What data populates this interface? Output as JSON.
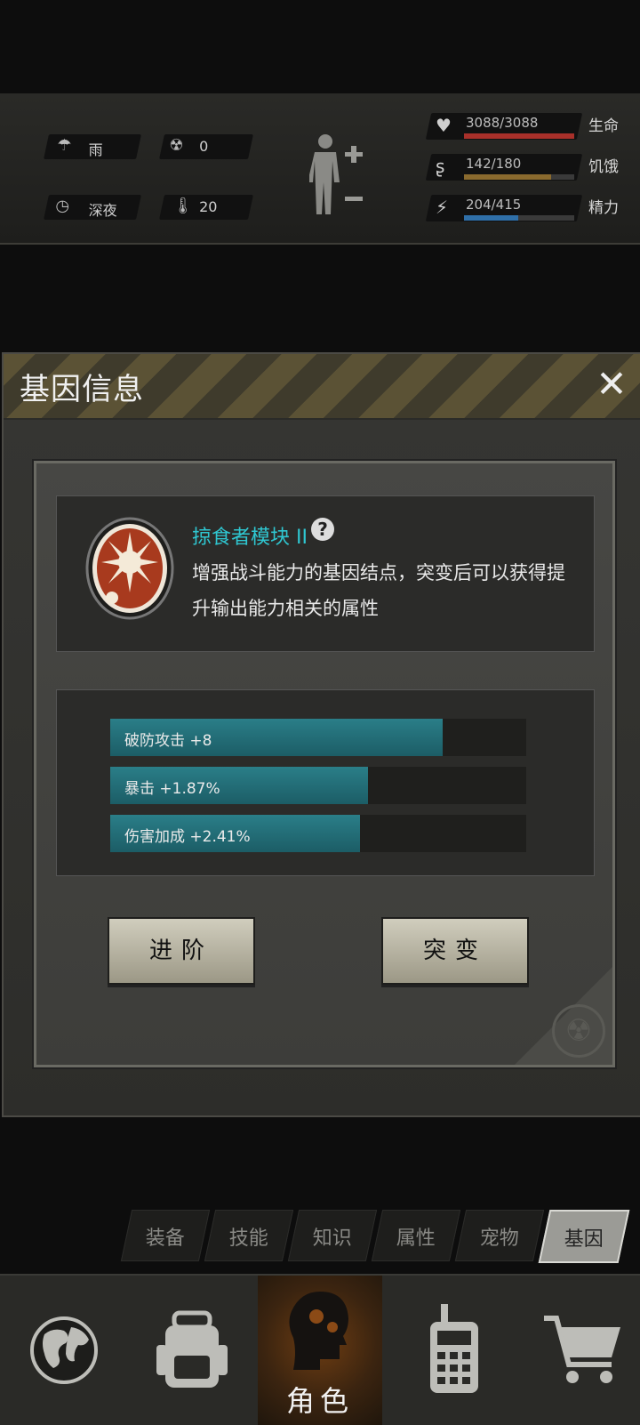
{
  "status": {
    "weather": "雨",
    "radiation": "0",
    "time": "深夜",
    "temperature": "20"
  },
  "vitals": [
    {
      "name": "生命",
      "value": "3088/3088",
      "ratio": 1.0,
      "color": "#a8302a",
      "icon": "heart-icon"
    },
    {
      "name": "饥饿",
      "value": "142/180",
      "ratio": 0.789,
      "color": "#8a6a2e",
      "icon": "stomach-icon"
    },
    {
      "name": "精力",
      "value": "204/415",
      "ratio": 0.492,
      "color": "#2f6fa8",
      "icon": "head-bolt-icon"
    }
  ],
  "dialog": {
    "title": "基因信息",
    "close_glyph": "✕",
    "gene": {
      "name": "掠食者模块 II",
      "help": "?",
      "description": "增强战斗能力的基因结点，突变后可以获得提升输出能力相关的属性"
    },
    "stats": [
      {
        "label": "破防攻击 +8",
        "fill": 0.8
      },
      {
        "label": "暴击 +1.87%",
        "fill": 0.62
      },
      {
        "label": "伤害加成 +2.41%",
        "fill": 0.6
      }
    ],
    "buttons": {
      "advance": "进阶",
      "mutate": "突变"
    }
  },
  "subtabs": [
    "装备",
    "技能",
    "知识",
    "属性",
    "宠物",
    "基因"
  ],
  "active_subtab": "基因",
  "nav": {
    "items": [
      "globe-icon",
      "backpack-icon",
      "character-icon",
      "walkie-talkie-icon",
      "cart-icon"
    ],
    "active_label": "角色"
  }
}
